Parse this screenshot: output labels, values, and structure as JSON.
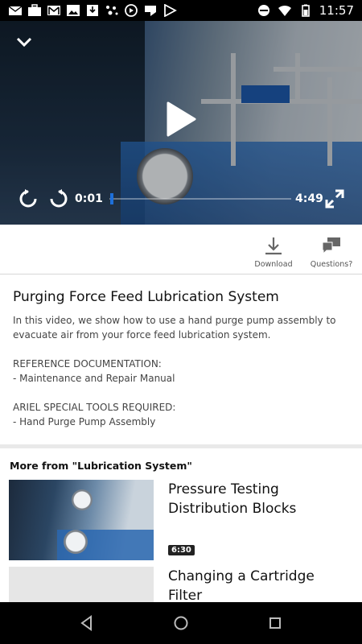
{
  "status_bar": {
    "time": "11:57",
    "left_icons": [
      "mail-icon",
      "briefcase-icon",
      "gmail-icon",
      "image-icon",
      "download-icon",
      "dots-icon",
      "play-circle-icon",
      "hangouts-icon",
      "play-store-icon"
    ],
    "right_icons": [
      "do-not-disturb-icon",
      "wifi-icon",
      "battery-icon"
    ]
  },
  "video": {
    "current_time": "0:01",
    "duration": "4:49",
    "progress": 0.0035
  },
  "actions": {
    "download_label": "Download",
    "questions_label": "Questions?"
  },
  "description": {
    "title": "Purging Force Feed Lubrication System",
    "intro": "In this video, we show how to use a hand purge pump assembly to evacuate air from your force feed lubrication system.",
    "ref_heading": "REFERENCE DOCUMENTATION:",
    "ref_item": "- Maintenance and Repair Manual",
    "tools_heading": "ARIEL SPECIAL TOOLS REQUIRED:",
    "tools_item": "- Hand Purge Pump Assembly"
  },
  "more": {
    "heading": "More from \"Lubrication System\"",
    "items": [
      {
        "title": "Pressure Testing Distribution Blocks",
        "duration": "6:30"
      },
      {
        "title": "Changing a Cartridge Filter",
        "duration": ""
      }
    ]
  },
  "colors": {
    "accent": "#1e6fd9",
    "status_bar": "#000000",
    "nav_bar": "#000000"
  }
}
